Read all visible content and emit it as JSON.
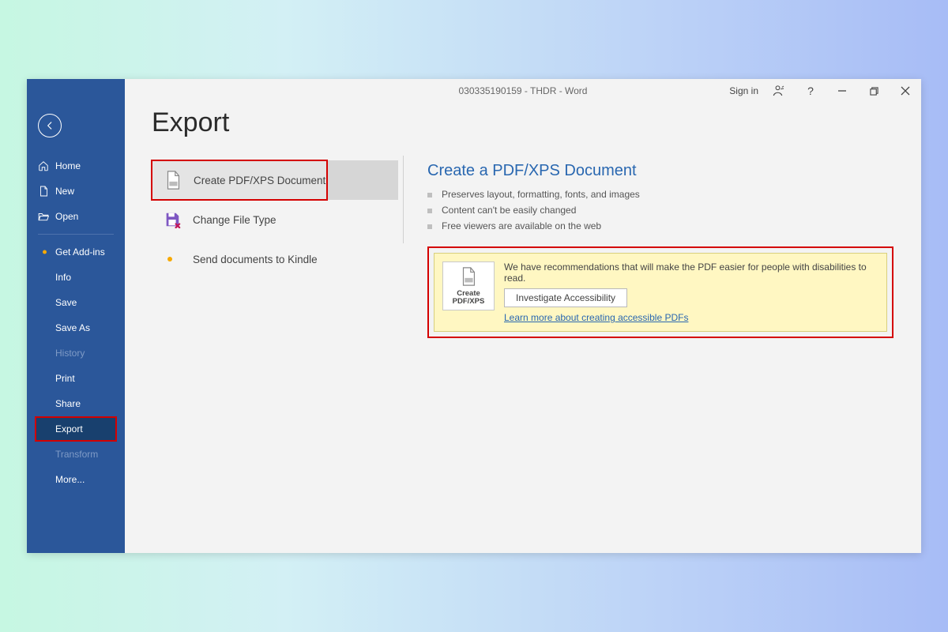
{
  "titlebar": {
    "document_title": "030335190159 - THDR  -  Word",
    "signin": "Sign in"
  },
  "sidebar": {
    "home": "Home",
    "new": "New",
    "open": "Open",
    "get_addins": "Get Add-ins",
    "info": "Info",
    "save": "Save",
    "save_as": "Save As",
    "history": "History",
    "print": "Print",
    "share": "Share",
    "export": "Export",
    "transform": "Transform",
    "more": "More..."
  },
  "page": {
    "title": "Export"
  },
  "tabs": {
    "create_pdf": "Create PDF/XPS Document",
    "change_type": "Change File Type",
    "kindle": "Send documents to Kindle"
  },
  "detail": {
    "heading": "Create a PDF/XPS Document",
    "bullets": [
      "Preserves layout, formatting, fonts, and images",
      "Content can't be easily changed",
      "Free viewers are available on the web"
    ],
    "recommend_text": "We have recommendations that will make the PDF easier for people with disabilities to read.",
    "investigate_btn": "Investigate Accessibility",
    "learn_link": "Learn more about creating accessible PDFs",
    "create_btn_line1": "Create",
    "create_btn_line2": "PDF/XPS"
  }
}
